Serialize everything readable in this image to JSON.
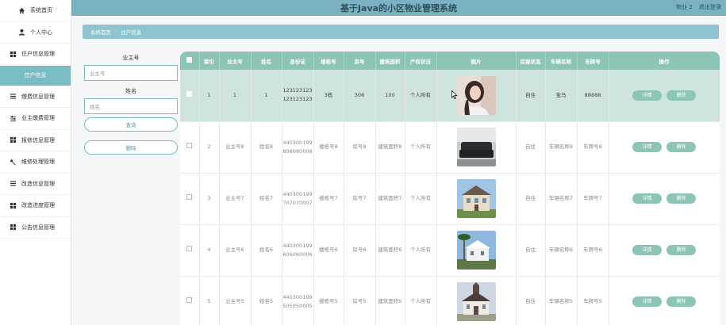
{
  "header": {
    "title": "基于Java的小区物业管理系统",
    "user": "物业 2",
    "logout": "退出登录"
  },
  "sidebar": {
    "items": [
      {
        "label": "系统首页",
        "icon": "home-icon"
      },
      {
        "label": "个人中心",
        "icon": "user-icon"
      },
      {
        "label": "住户信息管理",
        "icon": "grid-icon"
      },
      {
        "label": "住户信息",
        "icon": ""
      },
      {
        "label": "缴费信息管理",
        "icon": "list-icon"
      },
      {
        "label": "业主缴费管理",
        "icon": "sliders-icon"
      },
      {
        "label": "报修信息管理",
        "icon": "grid-icon"
      },
      {
        "label": "维修处理管理",
        "icon": "wrench-icon"
      },
      {
        "label": "改造信息管理",
        "icon": "list-icon"
      },
      {
        "label": "改造进度管理",
        "icon": "grid-icon"
      },
      {
        "label": "公告信息管理",
        "icon": "grid-icon"
      }
    ]
  },
  "breadcrumb": {
    "home": "系统首页",
    "sep": ":",
    "current": "住户信息"
  },
  "search": {
    "owner_label": "业主号",
    "owner_placeholder": "业主号",
    "name_label": "姓名",
    "name_placeholder": "姓名",
    "query_label": "查询",
    "delete_label": "删除"
  },
  "table": {
    "headers": [
      "",
      "索引",
      "业主号",
      "姓名",
      "身份证",
      "楼栋号",
      "房号",
      "建筑面积",
      "产权状况",
      "图片",
      "房屋状态",
      "车辆名称",
      "车牌号",
      "操作"
    ],
    "detail_label": "详情",
    "delete_label": "删除",
    "rows": [
      {
        "index": "1",
        "owner": "1",
        "name": "1",
        "idcard": "123123123123123123",
        "building": "3栋",
        "room": "308",
        "area": "100",
        "property": "个人所有",
        "image": "photo-woman",
        "status": "自住",
        "car": "宝马",
        "plate": "88888"
      },
      {
        "index": "2",
        "owner": "业主号8",
        "name": "姓名8",
        "idcard": "440300199808080008",
        "building": "楼栋号8",
        "room": "房号8",
        "area": "建筑面积8",
        "property": "个人所有",
        "image": "photo-sofa",
        "status": "自住",
        "car": "车辆名称8",
        "plate": "车牌号8"
      },
      {
        "index": "3",
        "owner": "业主号7",
        "name": "姓名7",
        "idcard": "440300199707070007",
        "building": "楼栋号7",
        "room": "房号7",
        "area": "建筑面积7",
        "property": "个人所有",
        "image": "photo-house",
        "status": "自住",
        "car": "车辆名称7",
        "plate": "车牌号7"
      },
      {
        "index": "4",
        "owner": "业主号6",
        "name": "姓名6",
        "idcard": "440300199606060006",
        "building": "楼栋号6",
        "room": "房号6",
        "area": "建筑面积6",
        "property": "个人所有",
        "image": "photo-palm-house",
        "status": "自住",
        "car": "车辆名称6",
        "plate": "车牌号6"
      },
      {
        "index": "5",
        "owner": "业主号5",
        "name": "姓名5",
        "idcard": "440300199505050005",
        "building": "楼栋号5",
        "room": "房号5",
        "area": "建筑面积5",
        "property": "个人所有",
        "image": "photo-church",
        "status": "自住",
        "car": "车辆名称5",
        "plate": "车牌号5"
      }
    ]
  },
  "colors": {
    "header": "#7ab2c4",
    "accent": "#8dc4b8",
    "sidebar_active": "#7bbcc2",
    "selected_row": "#cfe3df"
  }
}
